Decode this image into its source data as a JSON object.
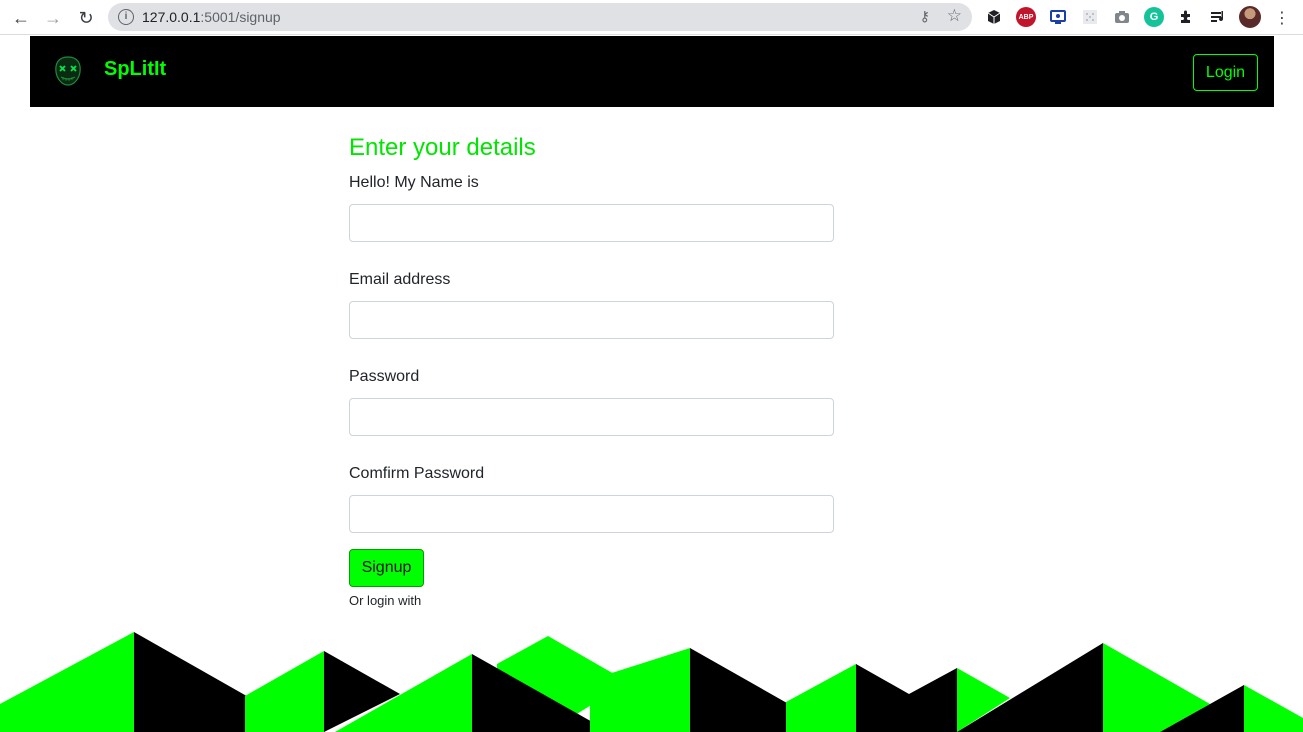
{
  "browser": {
    "url_host": "127.0.0.1",
    "url_port_path": ":5001/signup",
    "back_icon": "←",
    "forward_icon": "→",
    "reload_icon": "↻",
    "info_icon": "i",
    "key_icon": "⚷",
    "star_icon": "☆",
    "extension_abp": "ABP",
    "extension_grammarly": "G",
    "menu_icon": "⋮"
  },
  "header": {
    "brand": "SpLitIt",
    "login_label": "Login"
  },
  "form": {
    "title": "Enter your details",
    "fields": [
      {
        "label": "Hello! My Name is",
        "value": ""
      },
      {
        "label": "Email address",
        "value": ""
      },
      {
        "label": "Password",
        "value": ""
      },
      {
        "label": "Comfirm Password",
        "value": ""
      }
    ],
    "submit_label": "Signup",
    "alt_text": "Or login with"
  },
  "colors": {
    "accent": "#00ff00",
    "navbar_bg": "#000000",
    "mountain_dark": "#000000",
    "mountain_light": "#00ff00"
  }
}
